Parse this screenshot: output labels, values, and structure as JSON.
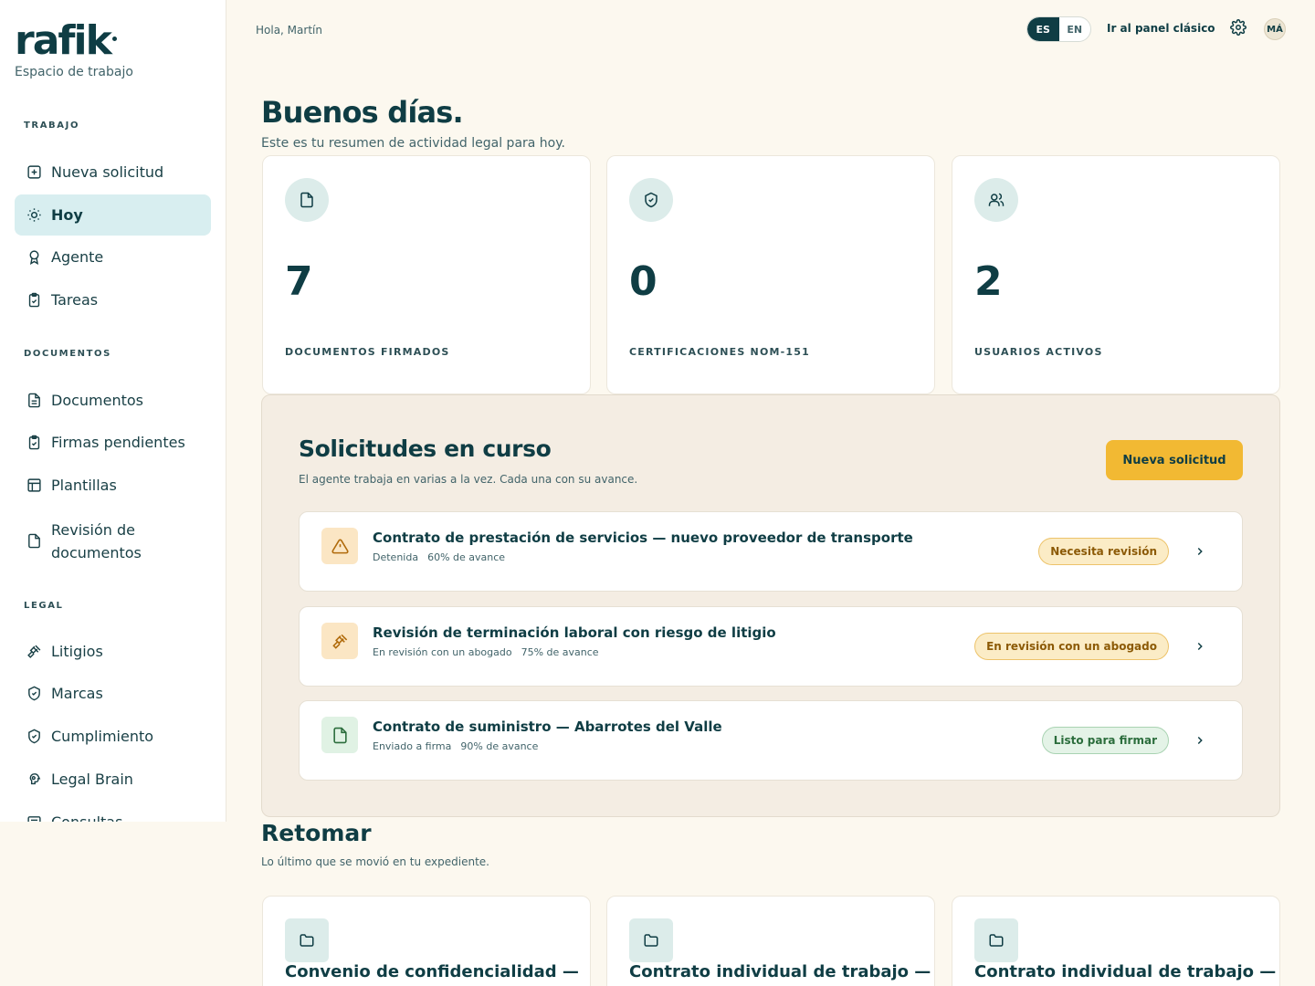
{
  "brand": {
    "logo_text": "rafik",
    "workspace": "Espacio de trabajo"
  },
  "sidebar": {
    "sections": [
      {
        "title": "TRABAJO"
      },
      {
        "title": "DOCUMENTOS"
      },
      {
        "title": "LEGAL"
      }
    ],
    "items": [
      {
        "label": "Nueva solicitud",
        "icon": "plus-square-icon"
      },
      {
        "label": "Hoy",
        "icon": "sun-icon",
        "active": true
      },
      {
        "label": "Agente",
        "icon": "award-icon"
      },
      {
        "label": "Tareas",
        "icon": "clipboard-check-icon"
      },
      {
        "label": "Documentos",
        "icon": "file-text-icon"
      },
      {
        "label": "Firmas pendientes",
        "icon": "clipboard-check-icon"
      },
      {
        "label": "Plantillas",
        "icon": "layout-icon"
      },
      {
        "label": "Revisión de documentos",
        "icon": "file-icon"
      },
      {
        "label": "Litigios",
        "icon": "gavel-icon"
      },
      {
        "label": "Marcas",
        "icon": "shield-check-icon"
      },
      {
        "label": "Cumplimiento",
        "icon": "shield-check-icon"
      },
      {
        "label": "Legal Brain",
        "icon": "brain-icon"
      },
      {
        "label": "Consultas",
        "icon": "message-icon"
      }
    ]
  },
  "topbar": {
    "greeting": "Hola, Martín",
    "languages": [
      "ES",
      "EN"
    ],
    "active_language": "ES",
    "classic_link": "Ir al panel clásico",
    "avatar_initials": "MÁ"
  },
  "hero": {
    "title": "Buenos días.",
    "subtitle": "Este es tu resumen de actividad legal para hoy."
  },
  "stats": [
    {
      "value": "7",
      "label": "DOCUMENTOS FIRMADOS",
      "icon": "file-icon"
    },
    {
      "value": "0",
      "label": "CERTIFICACIONES NOM-151",
      "icon": "shield-check-icon"
    },
    {
      "value": "2",
      "label": "USUARIOS ACTIVOS",
      "icon": "users-icon"
    }
  ],
  "requests": {
    "title": "Solicitudes en curso",
    "subtitle": "El agente trabaja en varias a la vez. Cada una con su avance.",
    "new_button": "Nueva solicitud",
    "items": [
      {
        "title": "Contrato de prestación de servicios — nuevo proveedor de transporte",
        "status": "Detenida",
        "progress_text": "60% de avance",
        "progress": 0.6,
        "badge": "Necesita revisión",
        "badge_type": "warn",
        "icon": "alert-triangle-icon"
      },
      {
        "title": "Revisión de terminación laboral con riesgo de litigio",
        "status": "En revisión con un abogado",
        "progress_text": "75% de avance",
        "progress": 0.75,
        "badge": "En revisión con un abogado",
        "badge_type": "warn",
        "icon": "gavel-icon"
      },
      {
        "title": "Contrato de suministro — Abarrotes del Valle",
        "status": "Enviado a firma",
        "progress_text": "90% de avance",
        "progress": 0.9,
        "badge": "Listo para firmar",
        "badge_type": "ok",
        "icon": "file-icon"
      }
    ]
  },
  "resume": {
    "title": "Retomar",
    "subtitle": "Lo último que se movió en tu expediente.",
    "items": [
      {
        "name": "Convenio de confidencialidad —",
        "icon": "folder-icon"
      },
      {
        "name": "Contrato individual de trabajo —",
        "icon": "folder-icon"
      },
      {
        "name": "Contrato individual de trabajo —",
        "icon": "folder-icon"
      }
    ]
  },
  "colors": {
    "primary": "#0f3d44",
    "accent": "#f2b933",
    "background": "#fcf8ef",
    "active_nav": "#d8eef0"
  }
}
